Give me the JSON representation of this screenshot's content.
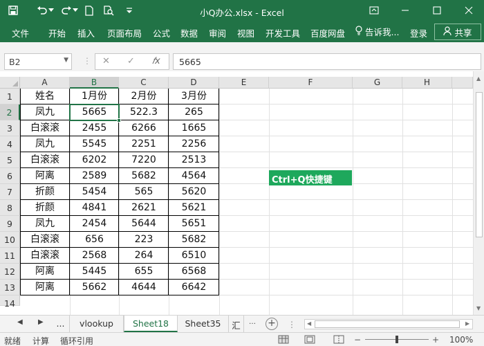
{
  "window": {
    "title": "小Q办公.xlsx - Excel"
  },
  "ribbon": {
    "tabs": [
      "文件",
      "开始",
      "插入",
      "页面布局",
      "公式",
      "数据",
      "审阅",
      "视图",
      "开发工具",
      "百度网盘"
    ],
    "tell_me": "告诉我...",
    "login": "登录",
    "share": "共享"
  },
  "formula_bar": {
    "name_box": "B2",
    "formula": "5665"
  },
  "grid": {
    "columns": [
      "A",
      "B",
      "C",
      "D",
      "E",
      "F",
      "G",
      "H"
    ],
    "rows": [
      "1",
      "2",
      "3",
      "4",
      "5",
      "6",
      "7",
      "8",
      "9",
      "10",
      "11",
      "12",
      "13",
      "14"
    ],
    "header_row": [
      "姓名",
      "1月份",
      "2月份",
      "3月份"
    ],
    "data": [
      [
        "凤九",
        "5665",
        "522.3",
        "265"
      ],
      [
        "白滚滚",
        "2455",
        "6266",
        "1665"
      ],
      [
        "凤九",
        "5545",
        "2251",
        "2256"
      ],
      [
        "白滚滚",
        "6202",
        "7220",
        "2513"
      ],
      [
        "阿离",
        "2589",
        "5682",
        "4564"
      ],
      [
        "折颜",
        "5454",
        "565",
        "5620"
      ],
      [
        "折颜",
        "4841",
        "2621",
        "5621"
      ],
      [
        "凤九",
        "2454",
        "5644",
        "5651"
      ],
      [
        "白滚滚",
        "656",
        "223",
        "5682"
      ],
      [
        "白滚滚",
        "2568",
        "264",
        "6510"
      ],
      [
        "阿离",
        "5445",
        "655",
        "6568"
      ],
      [
        "阿离",
        "5662",
        "4644",
        "6642"
      ]
    ],
    "note": "Ctrl+Q快捷键",
    "selected_cell": "B2",
    "selected_column": "B",
    "selected_row": "2"
  },
  "sheets": {
    "ellipsis": "...",
    "tabs": [
      "vlookup",
      "Sheet18",
      "Sheet35",
      "汇"
    ],
    "active": "Sheet18"
  },
  "status_bar": {
    "items": [
      "就绪",
      "计算",
      "循环引用"
    ],
    "zoom": "100%"
  },
  "colors": {
    "accent": "#217346",
    "note_bg": "#1ea85c"
  },
  "icons": [
    "excel-save-icon",
    "undo-icon",
    "redo-icon",
    "new-file-icon",
    "print-preview-icon",
    "customize-qat-icon",
    "ribbon-display-icon",
    "minimize-icon",
    "maximize-icon",
    "close-icon",
    "lightbulb-icon",
    "person-icon",
    "cancel-icon",
    "enter-icon",
    "fx-icon"
  ]
}
